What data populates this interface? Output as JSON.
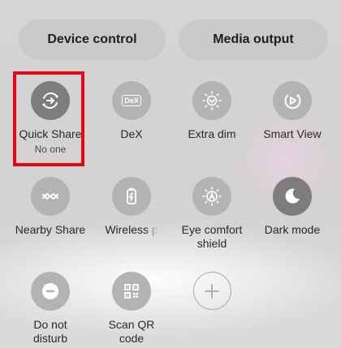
{
  "top_buttons": {
    "device_control": "Device control",
    "media_output": "Media output"
  },
  "tiles": [
    {
      "label": "Quick Share",
      "sublabel": "No one",
      "icon": "quick-share-icon",
      "active": true
    },
    {
      "label": "DeX",
      "icon": "dex-icon",
      "active": false
    },
    {
      "label": "Extra dim",
      "icon": "extra-dim-icon",
      "active": false
    },
    {
      "label": "Smart View",
      "icon": "smart-view-icon",
      "active": false
    },
    {
      "label": "Nearby Share",
      "icon": "nearby-share-icon",
      "active": false
    },
    {
      "label": "Wireless p",
      "icon": "wireless-powershare-icon",
      "active": false
    },
    {
      "label": "Eye comfort shield",
      "icon": "eye-comfort-icon",
      "active": false
    },
    {
      "label": "Dark mode",
      "icon": "dark-mode-icon",
      "active": false
    },
    {
      "label": "Do not disturb",
      "icon": "minus-circle-icon",
      "active": false
    },
    {
      "label": "Scan QR code",
      "icon": "qr-code-icon",
      "active": false
    },
    {
      "label": "",
      "icon": "add-icon",
      "active": false
    }
  ],
  "dex_icon_text": "DeX",
  "highlight_color": "#e3061a"
}
